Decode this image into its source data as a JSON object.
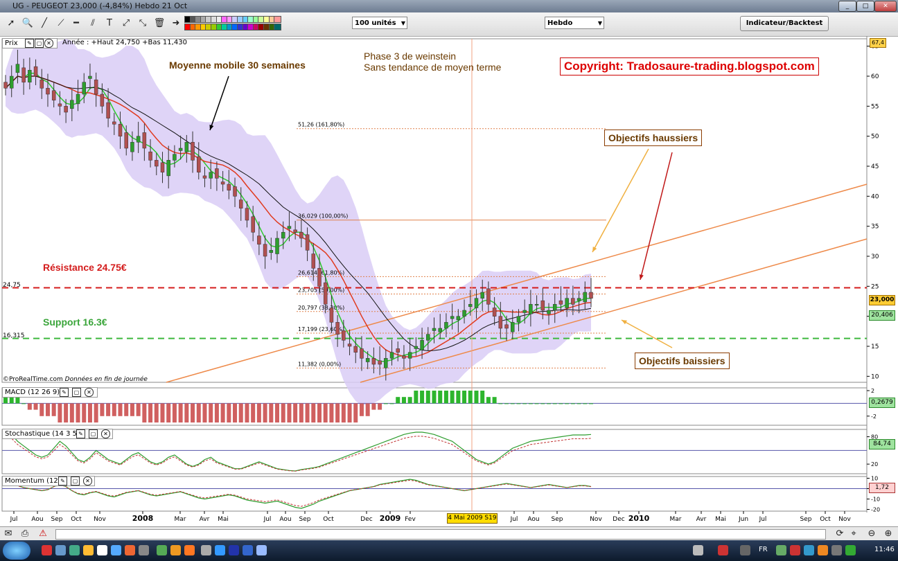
{
  "window": {
    "title": "UG - PEUGEOT    23,000 (-4,84%)    Hebdo  21 Oct"
  },
  "toolbar": {
    "units_select": "100 unités",
    "period_select": "Hebdo",
    "indicator_button": "Indicateur/Backtest"
  },
  "price_panel": {
    "label": "Prix",
    "info": "Année : +Haut 24,750 +Bas 11,430",
    "credit_brand": "©ProRealTime.com",
    "credit_note": "Données en fin de journée",
    "annotations": {
      "moving_average": "Moyenne mobile 30 semaines",
      "phase_line1": "Phase 3 de weinstein",
      "phase_line2": "Sans tendance de moyen terme",
      "copyright": "Copyright: Tradosaure-trading.blogspot.com",
      "bull_targets": "Objectifs haussiers",
      "bear_targets": "Objectifs baissiers",
      "resistance": "Résistance 24.75€",
      "support": "Support 16.3€"
    },
    "level_labels": {
      "resistance": "24,75",
      "support": "16,315"
    },
    "badges": {
      "top": "67,4",
      "last": "23,000",
      "ma": "20,406"
    }
  },
  "macd_panel": {
    "label": "MACD (12 26 9)",
    "badge": "0,2679"
  },
  "stoch_panel": {
    "label": "Stochastique (14 3 5)",
    "badge": "84,74"
  },
  "momentum_panel": {
    "label": "Momentum (12)",
    "badge": "1,72"
  },
  "xaxis": {
    "cursor_label": "4 Mai 2009 S19"
  },
  "taskbar": {
    "lang": "FR",
    "clock": "11:46"
  },
  "colors": {
    "up_candle": "#2e9e2e",
    "down_candle": "#b05050",
    "bollinger": "#d9cdf6",
    "ma_short": "#2ec92e",
    "ma_long_red": "#e03a1e",
    "ma_30": "#111111",
    "channel": "#ee8a4a",
    "resistance": "#d41c1c",
    "support": "#3cb83c",
    "fibo": "#e0804a",
    "annotation_brown": "#8a3c00"
  },
  "chart_data": [
    {
      "type": "candlestick",
      "title": "UG - PEUGEOT",
      "ylim": [
        9,
        66
      ],
      "yticks": [
        10,
        15,
        20,
        25,
        30,
        35,
        40,
        45,
        50,
        55,
        60,
        65
      ],
      "xticks": [
        "Jul",
        "Aou",
        "Sep",
        "Oct",
        "Nov",
        "2008",
        "Mar",
        "Avr",
        "Mai",
        "Jul",
        "Aou",
        "Sep",
        "Oct",
        "Dec",
        "2009",
        "Fev",
        "Jul",
        "Aou",
        "Sep",
        "Nov",
        "Dec",
        "2010",
        "Mar",
        "Avr",
        "Mai",
        "Jun",
        "Jul",
        "Sep",
        "Oct",
        "Nov"
      ],
      "closes": [
        58,
        60,
        62,
        59,
        61,
        60,
        58,
        57,
        56,
        55,
        54,
        56,
        57,
        59,
        60,
        57,
        55,
        53,
        52,
        50,
        48,
        49,
        50,
        48,
        46,
        45,
        44,
        46,
        47,
        48,
        49,
        46,
        44,
        43,
        44,
        43,
        42,
        41,
        40,
        38,
        36,
        34,
        32,
        30,
        31,
        33,
        34,
        35,
        34,
        33,
        31,
        28,
        25,
        22,
        19,
        17,
        16,
        15,
        14,
        13,
        13,
        12,
        12,
        13,
        14,
        14,
        13,
        14,
        15,
        16,
        17,
        18,
        18,
        19,
        20,
        20,
        21,
        22,
        23,
        24,
        22,
        20,
        18,
        18,
        19,
        20,
        21,
        22,
        22,
        21,
        21,
        22,
        22,
        23,
        22,
        23,
        24,
        23
      ],
      "levels": {
        "resistance": 24.75,
        "support": 16.315
      },
      "fibonacci": [
        {
          "label": "51,26 (161,80%)",
          "value": 51.26
        },
        {
          "label": "36,029 (100,00%)",
          "value": 36.029
        },
        {
          "label": "26,614 (61,80%)",
          "value": 26.614
        },
        {
          "label": "23,705 (50,00%)",
          "value": 23.705
        },
        {
          "label": "20,797 (38,20%)",
          "value": 20.797
        },
        {
          "label": "17,199 (23,60%)",
          "value": 17.199
        },
        {
          "label": "11,382 (0,00%)",
          "value": 11.382
        }
      ]
    },
    {
      "type": "bar",
      "title": "MACD (12 26 9)",
      "yticks": [
        2,
        -2
      ],
      "values": [
        1,
        1,
        1,
        0,
        -1,
        -1,
        -2,
        -2,
        -2,
        -3,
        -3,
        -3,
        -3,
        -3,
        -3,
        -3,
        -2,
        -2,
        -2,
        -2,
        -2,
        -2,
        -2,
        -3,
        -3,
        -3,
        -3,
        -3,
        -3,
        -3,
        -3,
        -3,
        -3,
        -3,
        -3,
        -3,
        -3,
        -3,
        -3,
        -3,
        -3,
        -3,
        -3,
        -3,
        -3,
        -3,
        -3,
        -3,
        -3,
        -3,
        -3,
        -3,
        -3,
        -3,
        -3,
        -3,
        -3,
        -3,
        -3,
        -2,
        -2,
        -1,
        -1,
        0,
        0,
        1,
        1,
        1,
        2,
        2,
        2,
        2,
        2,
        2,
        2,
        2,
        2,
        2,
        2,
        2,
        1,
        1,
        0,
        0,
        0,
        0,
        0,
        0,
        0,
        0,
        0,
        0,
        0,
        0,
        0,
        0,
        0,
        0
      ]
    },
    {
      "type": "line",
      "title": "Stochastique (14 3 5)",
      "yticks": [
        80,
        20
      ],
      "values": [
        90,
        85,
        70,
        60,
        50,
        40,
        35,
        40,
        55,
        70,
        60,
        45,
        30,
        25,
        35,
        50,
        40,
        30,
        25,
        20,
        30,
        40,
        45,
        35,
        25,
        20,
        25,
        35,
        40,
        30,
        20,
        15,
        20,
        30,
        35,
        25,
        20,
        15,
        10,
        10,
        15,
        20,
        25,
        20,
        15,
        10,
        8,
        6,
        5,
        8,
        10,
        12,
        15,
        20,
        25,
        30,
        35,
        40,
        45,
        50,
        55,
        60,
        65,
        70,
        75,
        80,
        85,
        88,
        90,
        90,
        88,
        85,
        80,
        75,
        70,
        60,
        50,
        40,
        30,
        25,
        20,
        25,
        35,
        45,
        55,
        60,
        65,
        70,
        72,
        74,
        76,
        78,
        80,
        82,
        84,
        84,
        84,
        85
      ]
    },
    {
      "type": "line",
      "title": "Momentum (12)",
      "yticks": [
        10,
        0,
        -10,
        -20
      ],
      "values": [
        6,
        5,
        3,
        1,
        0,
        -1,
        -2,
        -1,
        2,
        4,
        2,
        -2,
        -5,
        -6,
        -4,
        -3,
        -5,
        -7,
        -8,
        -6,
        -4,
        -3,
        -2,
        -4,
        -6,
        -7,
        -6,
        -5,
        -4,
        -3,
        -5,
        -7,
        -9,
        -10,
        -9,
        -8,
        -7,
        -6,
        -7,
        -9,
        -11,
        -12,
        -13,
        -14,
        -13,
        -12,
        -14,
        -16,
        -18,
        -19,
        -17,
        -15,
        -12,
        -10,
        -8,
        -6,
        -4,
        -2,
        -1,
        0,
        1,
        2,
        4,
        5,
        6,
        7,
        8,
        9,
        8,
        6,
        4,
        3,
        2,
        1,
        0,
        -1,
        -2,
        -1,
        0,
        1,
        2,
        3,
        4,
        5,
        4,
        3,
        2,
        1,
        2,
        3,
        4,
        3,
        2,
        1,
        2,
        3,
        3,
        2
      ]
    }
  ]
}
